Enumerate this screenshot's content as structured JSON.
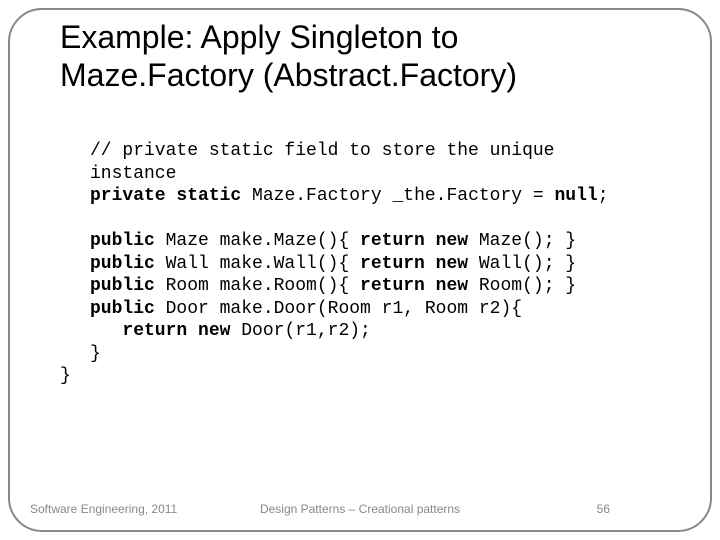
{
  "title": "Example: Apply Singleton to\n Maze.Factory (Abstract.Factory)",
  "code": {
    "c1a": "// private static field to store the unique",
    "c1b": "instance",
    "c2a": "private static",
    "c2b": " Maze.Factory _the.Factory = ",
    "c2c": "null",
    "c2d": ";",
    "l3a": "public",
    "l3b": " Maze make.Maze(){ ",
    "l3c": "return new",
    "l3d": " Maze(); }",
    "l4a": "public",
    "l4b": " Wall make.Wall(){ ",
    "l4c": "return new",
    "l4d": " Wall(); }",
    "l5a": "public",
    "l5b": " Room make.Room(){ ",
    "l5c": "return new",
    "l5d": " Room(); }",
    "l6a": "public",
    "l6b": " Door make.Door(Room r1, Room r2){",
    "l7a": "   ",
    "l7b": "return new",
    "l7c": " Door(r1,r2);",
    "l8": "}",
    "l9": "}"
  },
  "footer": {
    "left": "Software Engineering, 2011",
    "center": "Design Patterns – Creational patterns",
    "right": "56"
  }
}
